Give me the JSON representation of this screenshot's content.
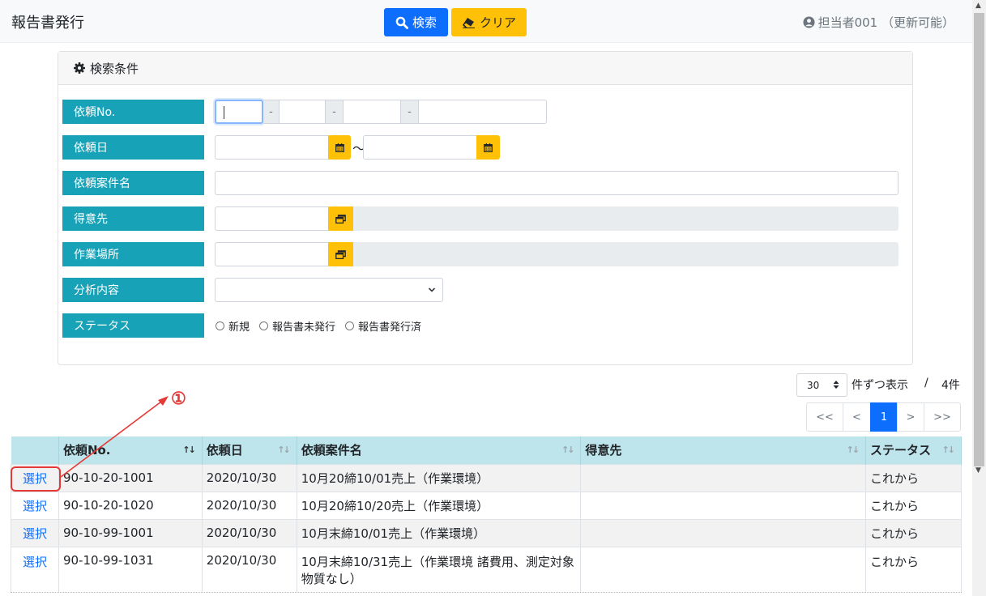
{
  "header": {
    "title": "報告書発行",
    "search_label": "検索",
    "clear_label": "クリア",
    "user": "担当者001 （更新可能）"
  },
  "search_panel": {
    "title": "検索条件",
    "fields": {
      "request_no": "依頼No.",
      "request_date": "依頼日",
      "request_name": "依頼案件名",
      "customer": "得意先",
      "work_place": "作業場所",
      "analysis": "分析内容",
      "status": "ステータス"
    },
    "separator": "-",
    "date_tilde": "〜",
    "status_options": [
      "新規",
      "報告書未発行",
      "報告書発行済"
    ]
  },
  "pagination": {
    "page_size": "30",
    "per_page_suffix": "件ずつ表示",
    "slash": "/",
    "total": "4件",
    "buttons": [
      "<<",
      "<",
      "1",
      ">",
      ">>"
    ],
    "active_page": "1"
  },
  "table": {
    "columns": [
      "",
      "依頼No.",
      "依頼日",
      "依頼案件名",
      "得意先",
      "ステータス"
    ],
    "rows": [
      {
        "select": "選択",
        "no": "90-10-20-1001",
        "date": "2020/10/30",
        "name": "10月20締10/01売上（作業環境）",
        "customer": "",
        "status": "これから"
      },
      {
        "select": "選択",
        "no": "90-10-20-1020",
        "date": "2020/10/30",
        "name": "10月20締10/20売上（作業環境）",
        "customer": "",
        "status": "これから"
      },
      {
        "select": "選択",
        "no": "90-10-99-1001",
        "date": "2020/10/30",
        "name": "10月末締10/01売上（作業環境）",
        "customer": "",
        "status": "これから"
      },
      {
        "select": "選択",
        "no": "90-10-99-1031",
        "date": "2020/10/30",
        "name": "10月末締10/31売上（作業環境 諸費用、測定対象物質なし）",
        "customer": "",
        "status": "これから"
      }
    ]
  },
  "annotation": {
    "number": "①",
    "color": "#e53935"
  },
  "colors": {
    "primary": "#0d6efd",
    "warning": "#ffc107",
    "label_bg": "#17a2b8",
    "table_head": "#bee5eb"
  }
}
